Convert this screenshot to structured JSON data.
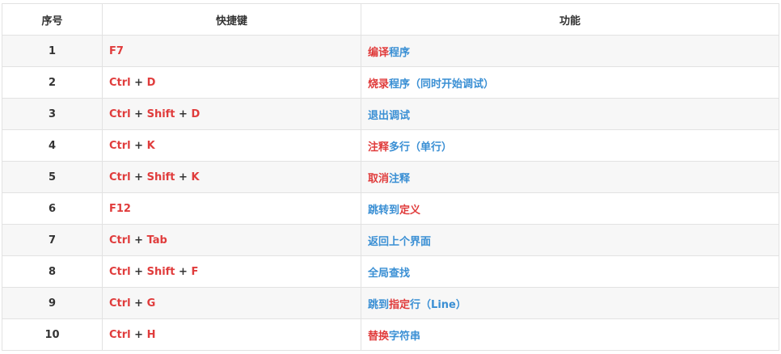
{
  "colors": {
    "key_text": "#e03c3c",
    "function_blue": "#3a8fd4",
    "function_red": "#e03c3c",
    "header_text": "#333333",
    "row_stripe": "#f7f7f7",
    "border": "#e2e2e2"
  },
  "table": {
    "headers": [
      "序号",
      "快捷键",
      "功能"
    ],
    "rows": [
      {
        "no": "1",
        "keys": [
          "F7"
        ],
        "func": [
          {
            "t": "编译",
            "c": "red"
          },
          {
            "t": "程序",
            "c": "blue"
          }
        ]
      },
      {
        "no": "2",
        "keys": [
          "Ctrl",
          "D"
        ],
        "func": [
          {
            "t": "烧录",
            "c": "red"
          },
          {
            "t": "程序（同时开始调试）",
            "c": "blue"
          }
        ]
      },
      {
        "no": "3",
        "keys": [
          "Ctrl",
          "Shift",
          "D"
        ],
        "func": [
          {
            "t": "退出调试",
            "c": "blue"
          }
        ]
      },
      {
        "no": "4",
        "keys": [
          "Ctrl",
          "K"
        ],
        "func": [
          {
            "t": "注释",
            "c": "red"
          },
          {
            "t": "多行（单行）",
            "c": "blue"
          }
        ]
      },
      {
        "no": "5",
        "keys": [
          "Ctrl",
          "Shift",
          "K"
        ],
        "func": [
          {
            "t": "取消",
            "c": "red"
          },
          {
            "t": "注释",
            "c": "blue"
          }
        ]
      },
      {
        "no": "6",
        "keys": [
          "F12"
        ],
        "func": [
          {
            "t": "跳转到",
            "c": "blue"
          },
          {
            "t": "定义",
            "c": "red"
          }
        ]
      },
      {
        "no": "7",
        "keys": [
          "Ctrl",
          "Tab"
        ],
        "func": [
          {
            "t": "返回上个界面",
            "c": "blue"
          }
        ]
      },
      {
        "no": "8",
        "keys": [
          "Ctrl",
          "Shift",
          "F"
        ],
        "func": [
          {
            "t": "全局查找",
            "c": "blue"
          }
        ]
      },
      {
        "no": "9",
        "keys": [
          "Ctrl",
          "G"
        ],
        "func": [
          {
            "t": "跳到",
            "c": "blue"
          },
          {
            "t": "指定",
            "c": "red"
          },
          {
            "t": "行（Line）",
            "c": "blue"
          }
        ]
      },
      {
        "no": "10",
        "keys": [
          "Ctrl",
          "H"
        ],
        "func": [
          {
            "t": "替换",
            "c": "red"
          },
          {
            "t": "字符串",
            "c": "blue"
          }
        ]
      }
    ]
  }
}
